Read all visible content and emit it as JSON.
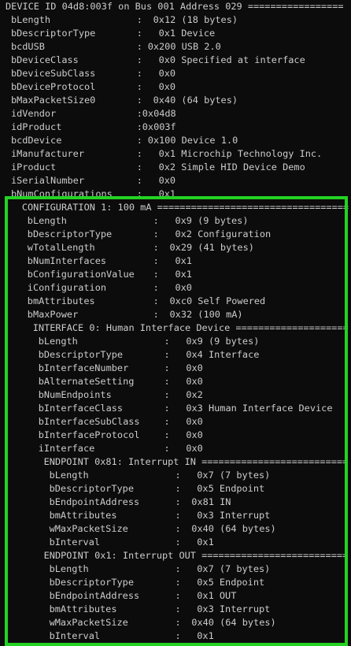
{
  "accent_color": "#24d224",
  "lines": [
    {
      "head": "DEVICE ID 04d8:003f on Bus 001 Address 029 =================",
      "indent": 0
    },
    {
      "f": "bLength",
      "v": "0x12 (18 bytes)",
      "indent": 1
    },
    {
      "f": "bDescriptorType",
      "v": "0x1 Device",
      "indent": 1
    },
    {
      "f": "bcdUSB",
      "v": "0x200 USB 2.0",
      "indent": 1
    },
    {
      "f": "bDeviceClass",
      "v": "0x0 Specified at interface",
      "indent": 1
    },
    {
      "f": "bDeviceSubClass",
      "v": "0x0",
      "indent": 1
    },
    {
      "f": "bDeviceProtocol",
      "v": "0x0",
      "indent": 1
    },
    {
      "f": "bMaxPacketSize0",
      "v": "0x40 (64 bytes)",
      "indent": 1
    },
    {
      "f": "idVendor",
      "v": "0x04d8",
      "indent": 1
    },
    {
      "f": "idProduct",
      "v": "0x003f",
      "indent": 1
    },
    {
      "f": "bcdDevice",
      "v": "0x100 Device 1.0",
      "indent": 1
    },
    {
      "f": "iManufacturer",
      "v": "0x1 Microchip Technology Inc.",
      "indent": 1
    },
    {
      "f": "iProduct",
      "v": "0x2 Simple HID Device Demo",
      "indent": 1
    },
    {
      "f": "iSerialNumber",
      "v": "0x0",
      "indent": 1
    },
    {
      "f": "bNumConfigurations",
      "v": "0x1",
      "indent": 1
    },
    {
      "head": "CONFIGURATION 1: 100 mA ==================================",
      "indent": 3
    },
    {
      "f": "bLength",
      "v": "0x9 (9 bytes)",
      "indent": 4
    },
    {
      "f": "bDescriptorType",
      "v": "0x2 Configuration",
      "indent": 4
    },
    {
      "f": "wTotalLength",
      "v": "0x29 (41 bytes)",
      "indent": 4
    },
    {
      "f": "bNumInterfaces",
      "v": "0x1",
      "indent": 4
    },
    {
      "f": "bConfigurationValue",
      "v": "0x1",
      "indent": 4
    },
    {
      "f": "iConfiguration",
      "v": "0x0",
      "indent": 4
    },
    {
      "f": "bmAttributes",
      "v": "0xc0 Self Powered",
      "indent": 4
    },
    {
      "f": "bMaxPower",
      "v": "0x32 (100 mA)",
      "indent": 4
    },
    {
      "head": "INTERFACE 0: Human Interface Device ====================",
      "indent": 5
    },
    {
      "f": "bLength",
      "v": "0x9 (9 bytes)",
      "indent": 6
    },
    {
      "f": "bDescriptorType",
      "v": "0x4 Interface",
      "indent": 6
    },
    {
      "f": "bInterfaceNumber",
      "v": "0x0",
      "indent": 6
    },
    {
      "f": "bAlternateSetting",
      "v": "0x0",
      "indent": 6
    },
    {
      "f": "bNumEndpoints",
      "v": "0x2",
      "indent": 6
    },
    {
      "f": "bInterfaceClass",
      "v": "0x3 Human Interface Device",
      "indent": 6
    },
    {
      "f": "bInterfaceSubClass",
      "v": "0x0",
      "indent": 6
    },
    {
      "f": "bInterfaceProtocol",
      "v": "0x0",
      "indent": 6
    },
    {
      "f": "iInterface",
      "v": "0x0",
      "indent": 6
    },
    {
      "head": "ENDPOINT 0x81: Interrupt IN ==========================",
      "indent": 7
    },
    {
      "f": "bLength",
      "v": "0x7 (7 bytes)",
      "indent": 8
    },
    {
      "f": "bDescriptorType",
      "v": "0x5 Endpoint",
      "indent": 8
    },
    {
      "f": "bEndpointAddress",
      "v": "0x81 IN",
      "indent": 8
    },
    {
      "f": "bmAttributes",
      "v": "0x3 Interrupt",
      "indent": 8
    },
    {
      "f": "wMaxPacketSize",
      "v": "0x40 (64 bytes)",
      "indent": 8
    },
    {
      "f": "bInterval",
      "v": "0x1",
      "indent": 8
    },
    {
      "head": "ENDPOINT 0x1: Interrupt OUT ==========================",
      "indent": 7
    },
    {
      "f": "bLength",
      "v": "0x7 (7 bytes)",
      "indent": 8
    },
    {
      "f": "bDescriptorType",
      "v": "0x5 Endpoint",
      "indent": 8
    },
    {
      "f": "bEndpointAddress",
      "v": "0x1 OUT",
      "indent": 8
    },
    {
      "f": "bmAttributes",
      "v": "0x3 Interrupt",
      "indent": 8
    },
    {
      "f": "wMaxPacketSize",
      "v": "0x40 (64 bytes)",
      "indent": 8
    },
    {
      "f": "bInterval",
      "v": "0x1",
      "indent": 8
    }
  ]
}
